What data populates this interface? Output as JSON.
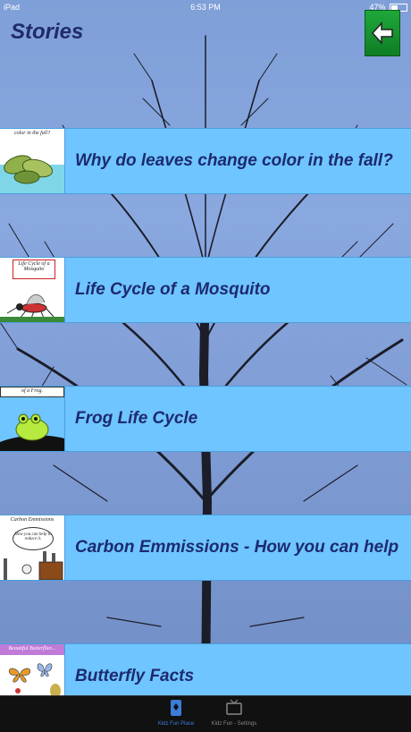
{
  "status_bar": {
    "carrier": "iPad",
    "time": "6:53 PM",
    "battery": "47%"
  },
  "header": {
    "title": "Stories"
  },
  "stories": [
    {
      "label": "Why do leaves change color in the fall?",
      "thumb_caption": "color in the fall?"
    },
    {
      "label": "Life Cycle of a Mosquito",
      "thumb_caption": "Life Cycle of a Mosquito"
    },
    {
      "label": "Frog Life Cycle",
      "thumb_caption": "of a Frog."
    },
    {
      "label": "Carbon Emmissions - How you can help",
      "thumb_caption": "Carbon Emmissions",
      "thumb_subcaption": "How you can help to reduce it."
    },
    {
      "label": "Butterfly Facts",
      "thumb_caption": "Beautiful Butterflies..."
    }
  ],
  "tab_bar": {
    "tabs": [
      {
        "label": "Kidz Fun Place",
        "icon": "card-icon",
        "active": true
      },
      {
        "label": "Kidz Fun - Settings",
        "icon": "tv-icon",
        "active": false
      }
    ]
  }
}
